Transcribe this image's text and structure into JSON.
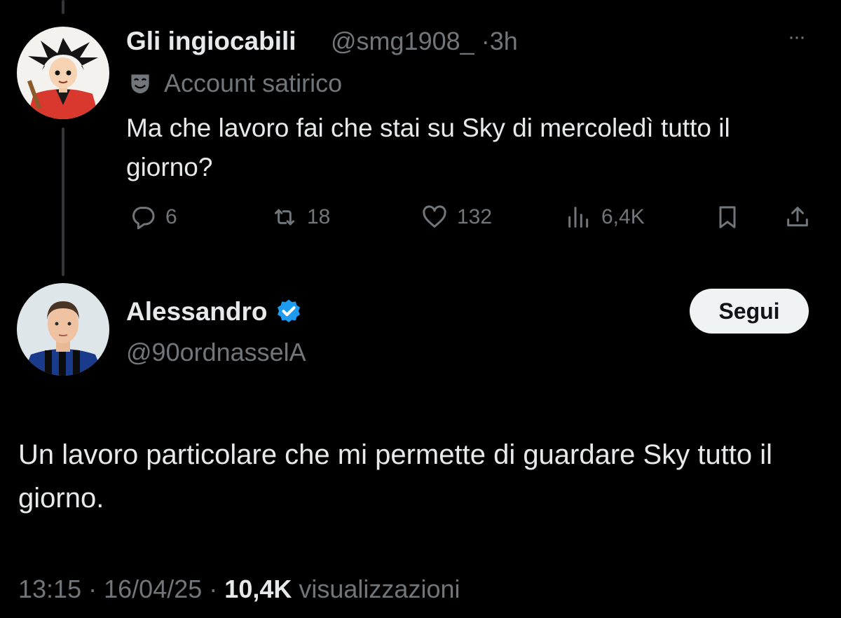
{
  "parent_tweet": {
    "display_name": "Gli ingiocabili",
    "handle": "@smg1908_",
    "separator": "·",
    "time": "3h",
    "more_label": "···",
    "label_text": "Account satirico",
    "text": "Ma che lavoro fai che stai su Sky di mercoledì tutto il giorno?",
    "actions": {
      "replies": "6",
      "reposts": "18",
      "likes": "132",
      "views": "6,4K"
    }
  },
  "reply_tweet": {
    "display_name": "Alessandro",
    "handle": "@90ordnasselA",
    "follow_label": "Segui",
    "text": "Un lavoro particolare che mi permette di guardare Sky tutto il giorno.",
    "time": "13:15",
    "separator": "·",
    "date": "16/04/25",
    "views_count": "10,4K",
    "views_label": "visualizzazioni"
  },
  "colors": {
    "background": "#000000",
    "text_primary": "#e7e9ea",
    "text_secondary": "#71767b",
    "verified": "#1d9bf0",
    "follow_button_bg": "#eff3f4"
  }
}
